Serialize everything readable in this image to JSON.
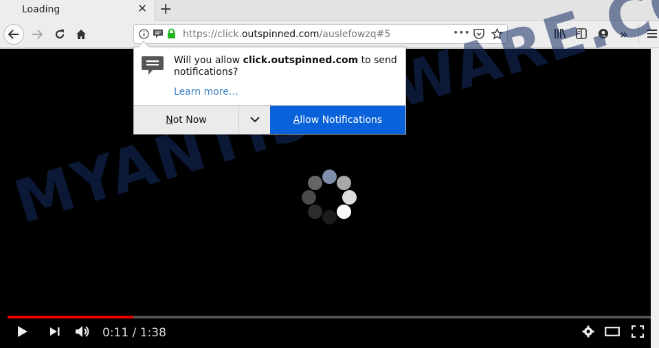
{
  "tab": {
    "title": "Loading",
    "close_icon": "close-icon",
    "new_tab_icon": "plus-icon"
  },
  "nav": {
    "url_prefix": "https://click.",
    "url_host": "outspinned.com",
    "url_path": "/auslefowzq#5",
    "page_actions_label": "•••"
  },
  "popup": {
    "msg_pre": "Will you allow ",
    "msg_host": "click.outspinned.com",
    "msg_post": " to send notifications?",
    "learn_more": "Learn more…",
    "not_now_accel": "N",
    "not_now_rest": "ot Now",
    "allow_accel": "A",
    "allow_rest": "llow Notifications"
  },
  "video": {
    "progress_fraction": 0.195,
    "time_display": "0:11 / 1:38",
    "accent_color": "#ee0000"
  },
  "watermark": "MYANTISPYWARE.COM"
}
